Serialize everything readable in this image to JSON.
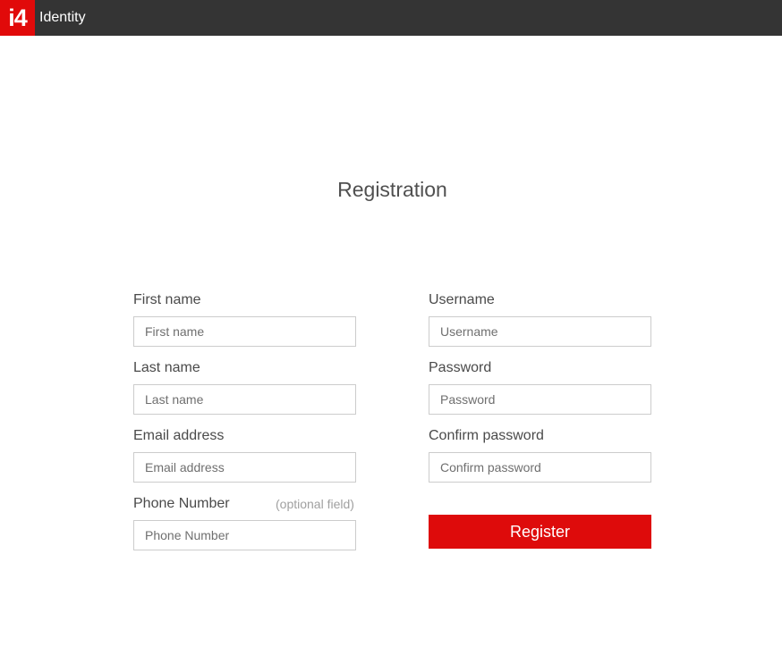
{
  "header": {
    "logo_text": "i4",
    "app_title": "Identity",
    "brand_color": "#e10a0a"
  },
  "page": {
    "title": "Registration"
  },
  "form": {
    "left": [
      {
        "label": "First name",
        "placeholder": "First name",
        "value": ""
      },
      {
        "label": "Last name",
        "placeholder": "Last name",
        "value": ""
      },
      {
        "label": "Email address",
        "placeholder": "Email address",
        "value": ""
      },
      {
        "label": "Phone Number",
        "placeholder": "Phone Number",
        "value": "",
        "note": "(optional field)"
      }
    ],
    "right": [
      {
        "label": "Username",
        "placeholder": "Username",
        "value": ""
      },
      {
        "label": "Password",
        "placeholder": "Password",
        "value": ""
      },
      {
        "label": "Confirm password",
        "placeholder": "Confirm password",
        "value": ""
      }
    ],
    "submit_label": "Register"
  }
}
